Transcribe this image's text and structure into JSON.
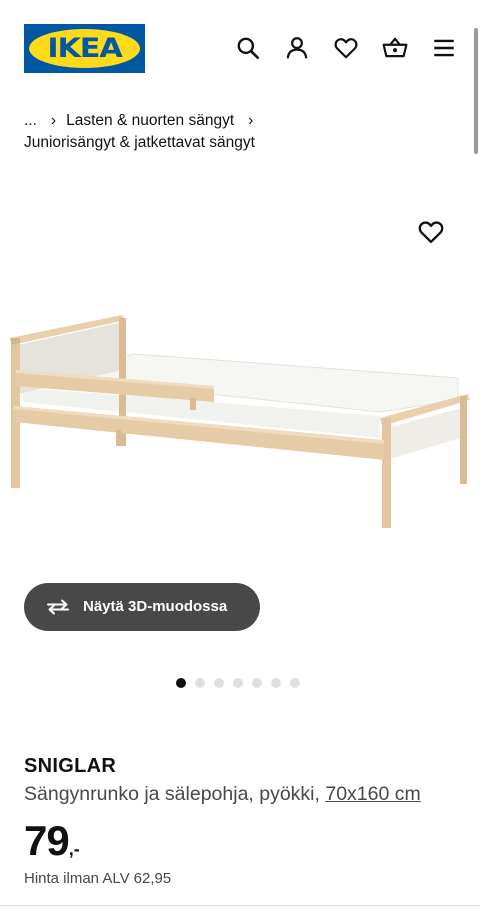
{
  "header": {
    "logo_text": "IKEA",
    "brand_blue": "#0058a3",
    "brand_yellow": "#ffda1a",
    "icons": [
      "search-icon",
      "account-icon",
      "favourites-icon",
      "basket-icon",
      "menu-icon"
    ]
  },
  "breadcrumb": {
    "ellipsis": "...",
    "items": [
      "Lasten & nuorten sängyt",
      "Juniorisängyt & jatkettavat sängyt"
    ]
  },
  "product_image": {
    "favourite_icon": "heart-icon",
    "carousel_count": 7,
    "active_index": 0
  },
  "view_3d": {
    "label": "Näytä 3D-muodossa",
    "icon": "rotate-3d-icon"
  },
  "product": {
    "name": "SNIGLAR",
    "description": "Sängynrunko ja sälepohja, pyökki,",
    "size_link": "70x160 cm",
    "price_integer": "79",
    "price_decimal": ",-",
    "vat_label": "Hinta ilman ALV",
    "vat_value": "62,95"
  }
}
